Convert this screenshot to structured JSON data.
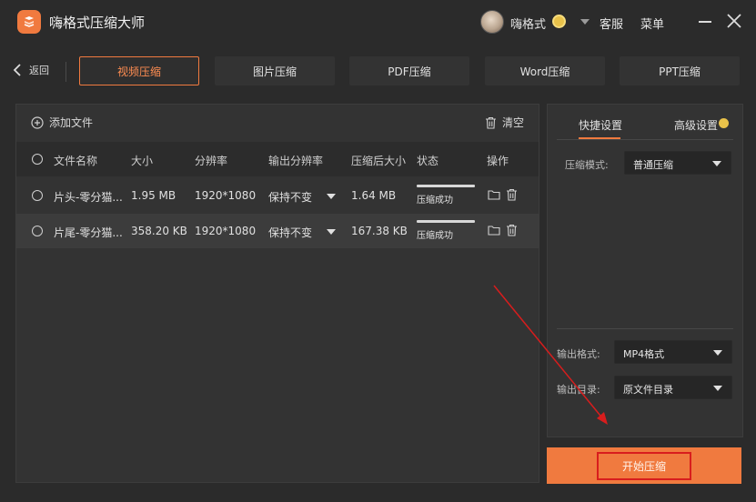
{
  "app": {
    "title": "嗨格式压缩大师",
    "username": "嗨格式",
    "kefu": "客服",
    "menu": "菜单"
  },
  "nav": {
    "back_label": "返回",
    "tabs": [
      {
        "label": "视频压缩",
        "active": true
      },
      {
        "label": "图片压缩",
        "active": false
      },
      {
        "label": "PDF压缩",
        "active": false
      },
      {
        "label": "Word压缩",
        "active": false
      },
      {
        "label": "PPT压缩",
        "active": false
      }
    ]
  },
  "toolbar": {
    "add_file": "添加文件",
    "clear": "清空"
  },
  "table": {
    "headers": [
      "文件名称",
      "大小",
      "分辨率",
      "输出分辨率",
      "压缩后大小",
      "状态",
      "操作"
    ],
    "rows": [
      {
        "name": "片头-零分猫...",
        "size": "1.95 MB",
        "resolution": "1920*1080",
        "output": "保持不变",
        "after": "1.64 MB",
        "status": "压缩成功",
        "progress": 1.0
      },
      {
        "name": "片尾-零分猫...",
        "size": "358.20 KB",
        "resolution": "1920*1080",
        "output": "保持不变",
        "after": "167.38 KB",
        "status": "压缩成功",
        "progress": 1.0
      }
    ]
  },
  "settings": {
    "tab_quick": "快捷设置",
    "tab_advanced": "高级设置",
    "mode_label": "压缩模式:",
    "mode_value": "普通压缩",
    "format_label": "输出格式:",
    "format_value": "MP4格式",
    "dir_label": "输出目录:",
    "dir_value": "原文件目录"
  },
  "start_button": "开始压缩",
  "colors": {
    "accent": "#f07a3f",
    "background": "#2b2b2b",
    "panel": "#333333",
    "annotation": "#d81d1d"
  }
}
